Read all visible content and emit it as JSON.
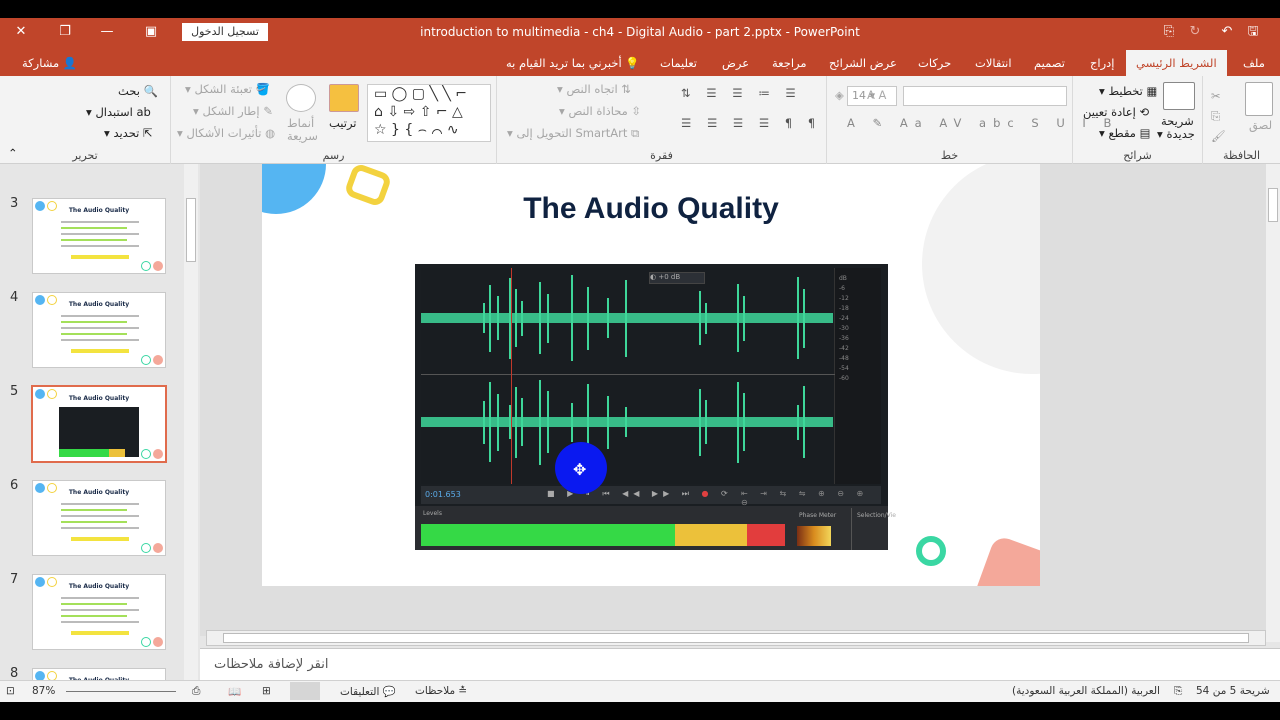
{
  "window": {
    "title": "introduction to multimedia - ch4 - Digital Audio - part 2.pptx  -  PowerPoint",
    "signin_label": "تسجيل الدخول"
  },
  "tabs": {
    "file": "ملف",
    "home": "الشريط الرئيسي",
    "insert": "إدراج",
    "design": "تصميم",
    "transitions": "انتقالات",
    "animations": "حركات",
    "slideshow": "عرض الشرائح",
    "review": "مراجعة",
    "view": "عرض",
    "help": "تعليمات",
    "tellme": "أخبرني بما تريد القيام به",
    "share": "مشاركة"
  },
  "ribbon": {
    "clipboard": {
      "label": "الحافظة",
      "paste": "لصق"
    },
    "slides": {
      "label": "شرائح",
      "new_slide": "شريحة",
      "new_slide2": "جديدة",
      "layout": "تخطيط",
      "reset": "إعادة تعيين",
      "section": "مقطع"
    },
    "font": {
      "label": "خط",
      "size": "14"
    },
    "paragraph": {
      "label": "فقرة",
      "text_direction": "اتجاه النص",
      "align_text": "محاذاة النص",
      "smartart": "التحويل إلى SmartArt"
    },
    "drawing": {
      "label": "رسم",
      "arrange": "ترتيب",
      "quick_styles": "أنماط",
      "quick_styles2": "سريعة",
      "fill": "تعبئة الشكل",
      "outline": "إطار الشكل",
      "effects": "تأثيرات الأشكال"
    },
    "editing": {
      "label": "تحرير",
      "find": "بحث",
      "replace": "استبدال",
      "select": "تحديد"
    }
  },
  "thumbnails": [
    {
      "num": "3",
      "title": "The Audio Quality"
    },
    {
      "num": "4",
      "title": "The Audio Quality"
    },
    {
      "num": "5",
      "title": "The Audio Quality"
    },
    {
      "num": "6",
      "title": "The Audio Quality"
    },
    {
      "num": "7",
      "title": "The Audio Quality"
    },
    {
      "num": "8",
      "title": "The Audio Quality"
    }
  ],
  "slide": {
    "title": "The Audio Quality",
    "editor": {
      "timecode": "0:01.653",
      "levels_label": "Levels",
      "phase_label": "Phase Meter",
      "selection_label": "Selection/Vie"
    }
  },
  "notes": {
    "placeholder": "انقر لإضافة ملاحظات"
  },
  "status": {
    "slide_counter": "شريحة 5 من 54",
    "language": "العربية (المملكة العربية السعودية)",
    "notes_btn": "ملاحظات",
    "comments_btn": "التعليقات",
    "zoom": "87%"
  },
  "colors": {
    "accent": "#c0452a",
    "wave": "#3ed79a",
    "slide_title": "#0f2240"
  }
}
